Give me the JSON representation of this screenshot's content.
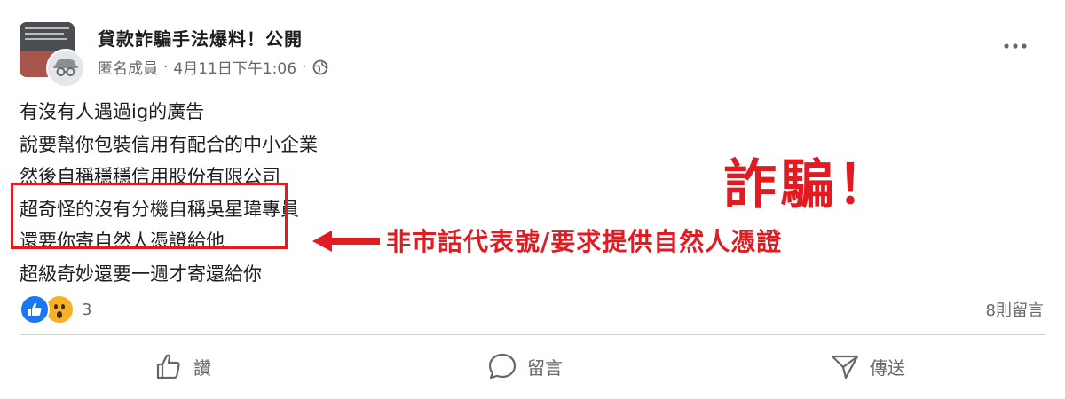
{
  "post": {
    "group_name": "貸款詐騙手法爆料！公開",
    "author": "匿名成員",
    "separator": "·",
    "timestamp": "4月11日下午1:06",
    "separator2": "·",
    "privacy_icon": "globe-icon",
    "lines": [
      "有沒有人遇過ig的廣告",
      "說要幫你包裝信用有配合的中小企業",
      "然後自稱穩穩信用股份有限公司",
      "超奇怪的沒有分機自稱吳星瑋專員",
      "還要你寄自然人憑證給他",
      "超級奇妙還要一週才寄還給你"
    ]
  },
  "annotation": {
    "text": "非市話代表號/要求提供自然人憑證",
    "stamp": "詐騙！",
    "color": "#e01b22"
  },
  "engagement": {
    "reaction_count": "3",
    "comments": "8則留言"
  },
  "actions": {
    "like_label": "讚",
    "comment_label": "留言",
    "share_label": "傳送"
  }
}
